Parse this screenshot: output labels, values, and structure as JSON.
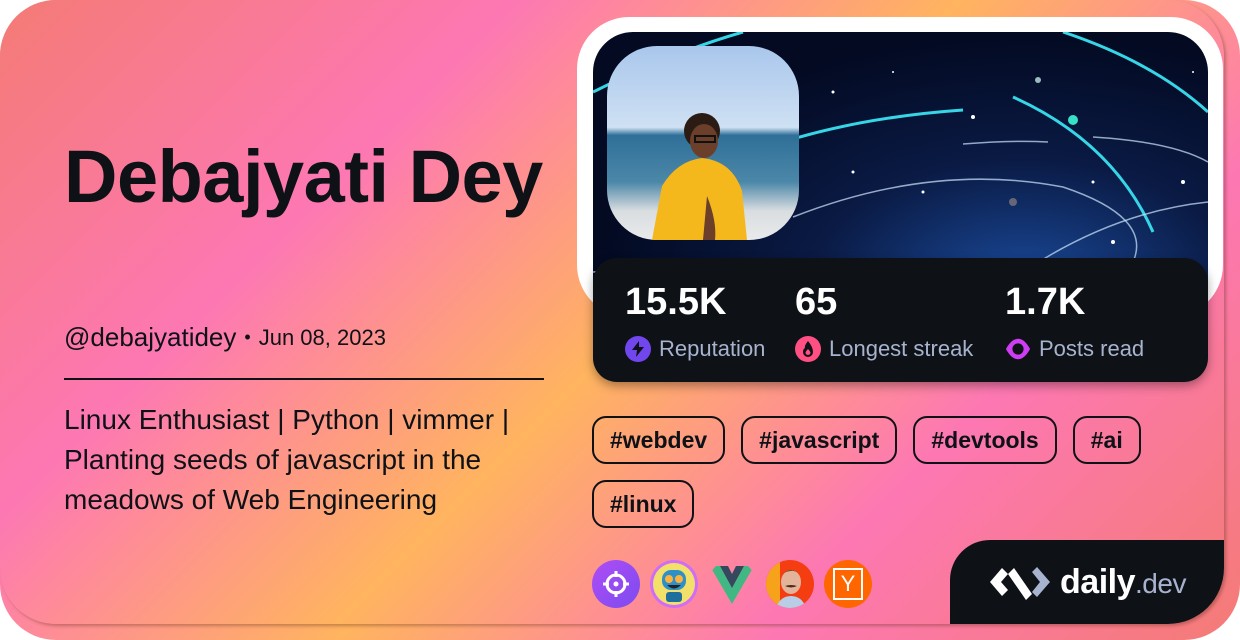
{
  "profile": {
    "name": "Debajyati Dey",
    "handle": "@debajyatidey",
    "separator": "•",
    "joined": "Jun 08, 2023",
    "bio": "Linux Enthusiast | Python | vimmer | Planting seeds of javascript in the meadows of Web Engineering"
  },
  "stats": [
    {
      "value": "15.5K",
      "label": "Reputation",
      "icon": "lightning-icon",
      "color": "#7147ed"
    },
    {
      "value": "65",
      "label": "Longest streak",
      "icon": "flame-icon",
      "color": "#ff4f83"
    },
    {
      "value": "1.7K",
      "label": "Posts read",
      "icon": "eye-icon",
      "color": "#ce3df3"
    }
  ],
  "tags": [
    "#webdev",
    "#javascript",
    "#devtools",
    "#ai",
    "#linux"
  ],
  "sources": [
    {
      "name": "crosshair-squad-icon",
      "color": "#a74cf5"
    },
    {
      "name": "robot-squad-icon",
      "color": "#cf6ef5"
    },
    {
      "name": "vue-icon",
      "color": "#41b883"
    },
    {
      "name": "person-source-icon",
      "color": "#f53d12"
    },
    {
      "name": "hacker-news-icon",
      "color": "#ff6600",
      "glyph": "Y"
    }
  ],
  "brand": {
    "main": "daily",
    "suffix": ".dev"
  },
  "colors": {
    "background_gradient": [
      "#f47b75",
      "#fd78b3",
      "#ffb45f"
    ],
    "dark": "#0e1217",
    "label": "#a8b3cf"
  }
}
